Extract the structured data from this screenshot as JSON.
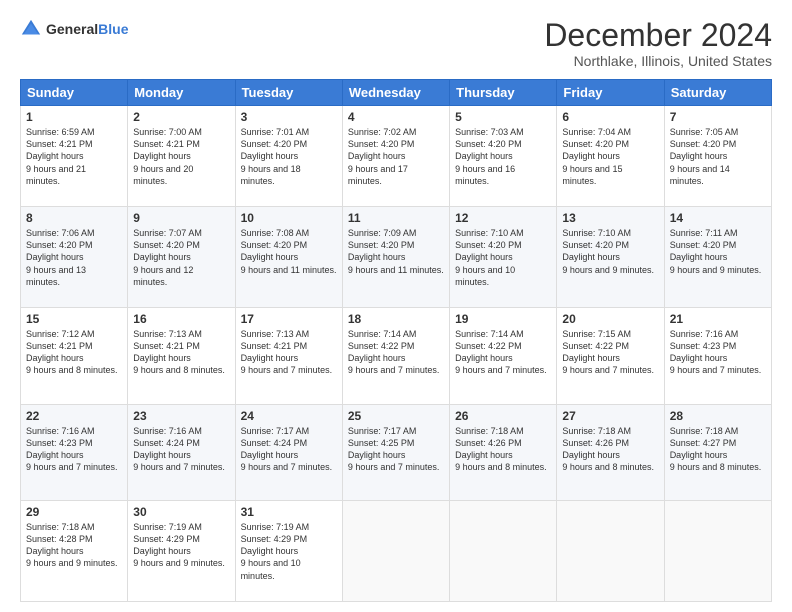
{
  "header": {
    "logo_general": "General",
    "logo_blue": "Blue",
    "title": "December 2024",
    "location": "Northlake, Illinois, United States"
  },
  "weekdays": [
    "Sunday",
    "Monday",
    "Tuesday",
    "Wednesday",
    "Thursday",
    "Friday",
    "Saturday"
  ],
  "weeks": [
    [
      {
        "day": "1",
        "sunrise": "6:59 AM",
        "sunset": "4:21 PM",
        "daylight": "9 hours and 21 minutes."
      },
      {
        "day": "2",
        "sunrise": "7:00 AM",
        "sunset": "4:21 PM",
        "daylight": "9 hours and 20 minutes."
      },
      {
        "day": "3",
        "sunrise": "7:01 AM",
        "sunset": "4:20 PM",
        "daylight": "9 hours and 18 minutes."
      },
      {
        "day": "4",
        "sunrise": "7:02 AM",
        "sunset": "4:20 PM",
        "daylight": "9 hours and 17 minutes."
      },
      {
        "day": "5",
        "sunrise": "7:03 AM",
        "sunset": "4:20 PM",
        "daylight": "9 hours and 16 minutes."
      },
      {
        "day": "6",
        "sunrise": "7:04 AM",
        "sunset": "4:20 PM",
        "daylight": "9 hours and 15 minutes."
      },
      {
        "day": "7",
        "sunrise": "7:05 AM",
        "sunset": "4:20 PM",
        "daylight": "9 hours and 14 minutes."
      }
    ],
    [
      {
        "day": "8",
        "sunrise": "7:06 AM",
        "sunset": "4:20 PM",
        "daylight": "9 hours and 13 minutes."
      },
      {
        "day": "9",
        "sunrise": "7:07 AM",
        "sunset": "4:20 PM",
        "daylight": "9 hours and 12 minutes."
      },
      {
        "day": "10",
        "sunrise": "7:08 AM",
        "sunset": "4:20 PM",
        "daylight": "9 hours and 11 minutes."
      },
      {
        "day": "11",
        "sunrise": "7:09 AM",
        "sunset": "4:20 PM",
        "daylight": "9 hours and 11 minutes."
      },
      {
        "day": "12",
        "sunrise": "7:10 AM",
        "sunset": "4:20 PM",
        "daylight": "9 hours and 10 minutes."
      },
      {
        "day": "13",
        "sunrise": "7:10 AM",
        "sunset": "4:20 PM",
        "daylight": "9 hours and 9 minutes."
      },
      {
        "day": "14",
        "sunrise": "7:11 AM",
        "sunset": "4:20 PM",
        "daylight": "9 hours and 9 minutes."
      }
    ],
    [
      {
        "day": "15",
        "sunrise": "7:12 AM",
        "sunset": "4:21 PM",
        "daylight": "9 hours and 8 minutes."
      },
      {
        "day": "16",
        "sunrise": "7:13 AM",
        "sunset": "4:21 PM",
        "daylight": "9 hours and 8 minutes."
      },
      {
        "day": "17",
        "sunrise": "7:13 AM",
        "sunset": "4:21 PM",
        "daylight": "9 hours and 7 minutes."
      },
      {
        "day": "18",
        "sunrise": "7:14 AM",
        "sunset": "4:22 PM",
        "daylight": "9 hours and 7 minutes."
      },
      {
        "day": "19",
        "sunrise": "7:14 AM",
        "sunset": "4:22 PM",
        "daylight": "9 hours and 7 minutes."
      },
      {
        "day": "20",
        "sunrise": "7:15 AM",
        "sunset": "4:22 PM",
        "daylight": "9 hours and 7 minutes."
      },
      {
        "day": "21",
        "sunrise": "7:16 AM",
        "sunset": "4:23 PM",
        "daylight": "9 hours and 7 minutes."
      }
    ],
    [
      {
        "day": "22",
        "sunrise": "7:16 AM",
        "sunset": "4:23 PM",
        "daylight": "9 hours and 7 minutes."
      },
      {
        "day": "23",
        "sunrise": "7:16 AM",
        "sunset": "4:24 PM",
        "daylight": "9 hours and 7 minutes."
      },
      {
        "day": "24",
        "sunrise": "7:17 AM",
        "sunset": "4:24 PM",
        "daylight": "9 hours and 7 minutes."
      },
      {
        "day": "25",
        "sunrise": "7:17 AM",
        "sunset": "4:25 PM",
        "daylight": "9 hours and 7 minutes."
      },
      {
        "day": "26",
        "sunrise": "7:18 AM",
        "sunset": "4:26 PM",
        "daylight": "9 hours and 8 minutes."
      },
      {
        "day": "27",
        "sunrise": "7:18 AM",
        "sunset": "4:26 PM",
        "daylight": "9 hours and 8 minutes."
      },
      {
        "day": "28",
        "sunrise": "7:18 AM",
        "sunset": "4:27 PM",
        "daylight": "9 hours and 8 minutes."
      }
    ],
    [
      {
        "day": "29",
        "sunrise": "7:18 AM",
        "sunset": "4:28 PM",
        "daylight": "9 hours and 9 minutes."
      },
      {
        "day": "30",
        "sunrise": "7:19 AM",
        "sunset": "4:29 PM",
        "daylight": "9 hours and 9 minutes."
      },
      {
        "day": "31",
        "sunrise": "7:19 AM",
        "sunset": "4:29 PM",
        "daylight": "9 hours and 10 minutes."
      },
      null,
      null,
      null,
      null
    ]
  ]
}
